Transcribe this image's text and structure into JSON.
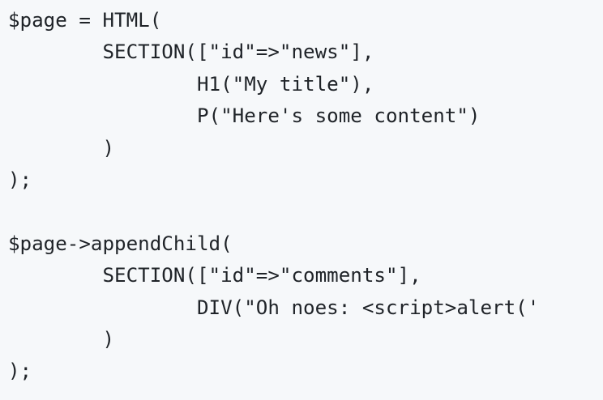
{
  "code": {
    "lines": [
      "$page = HTML(",
      "        SECTION([\"id\"=>\"news\"],",
      "                H1(\"My title\"),",
      "                P(\"Here's some content\")",
      "        )",
      ");",
      "",
      "$page->appendChild(",
      "        SECTION([\"id\"=>\"comments\"],",
      "                DIV(\"Oh noes: <script>alert('",
      "        )",
      ");"
    ]
  }
}
